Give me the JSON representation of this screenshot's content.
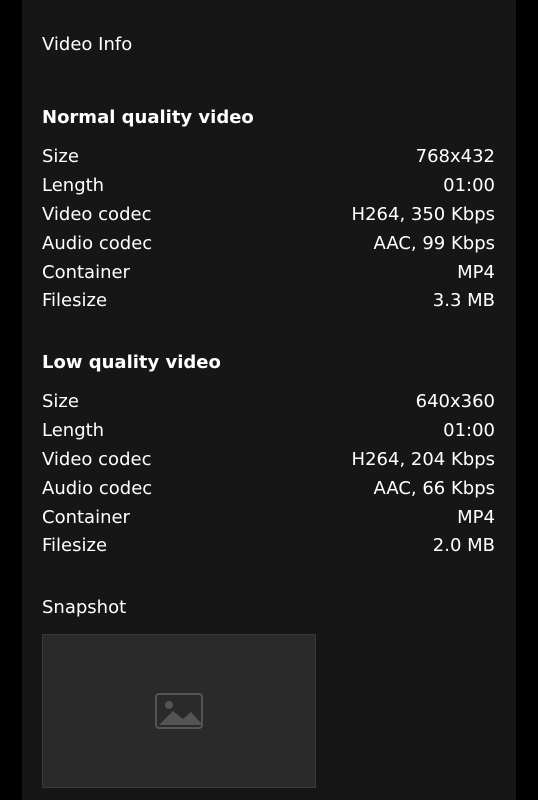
{
  "title": "Video Info",
  "sections": [
    {
      "heading": "Normal quality video",
      "rows": [
        {
          "label": "Size",
          "value": "768x432"
        },
        {
          "label": "Length",
          "value": "01:00"
        },
        {
          "label": "Video codec",
          "value": "H264, 350 Kbps"
        },
        {
          "label": "Audio codec",
          "value": "AAC, 99 Kbps"
        },
        {
          "label": "Container",
          "value": "MP4"
        },
        {
          "label": "Filesize",
          "value": "3.3 MB"
        }
      ]
    },
    {
      "heading": "Low quality video",
      "rows": [
        {
          "label": "Size",
          "value": "640x360"
        },
        {
          "label": "Length",
          "value": "01:00"
        },
        {
          "label": "Video codec",
          "value": "H264, 204 Kbps"
        },
        {
          "label": "Audio codec",
          "value": "AAC, 66 Kbps"
        },
        {
          "label": "Container",
          "value": "MP4"
        },
        {
          "label": "Filesize",
          "value": "2.0 MB"
        }
      ]
    }
  ],
  "snapshot": {
    "heading": "Snapshot"
  },
  "colors": {
    "background": "#000000",
    "panel": "#161616",
    "text": "#ffffff"
  }
}
